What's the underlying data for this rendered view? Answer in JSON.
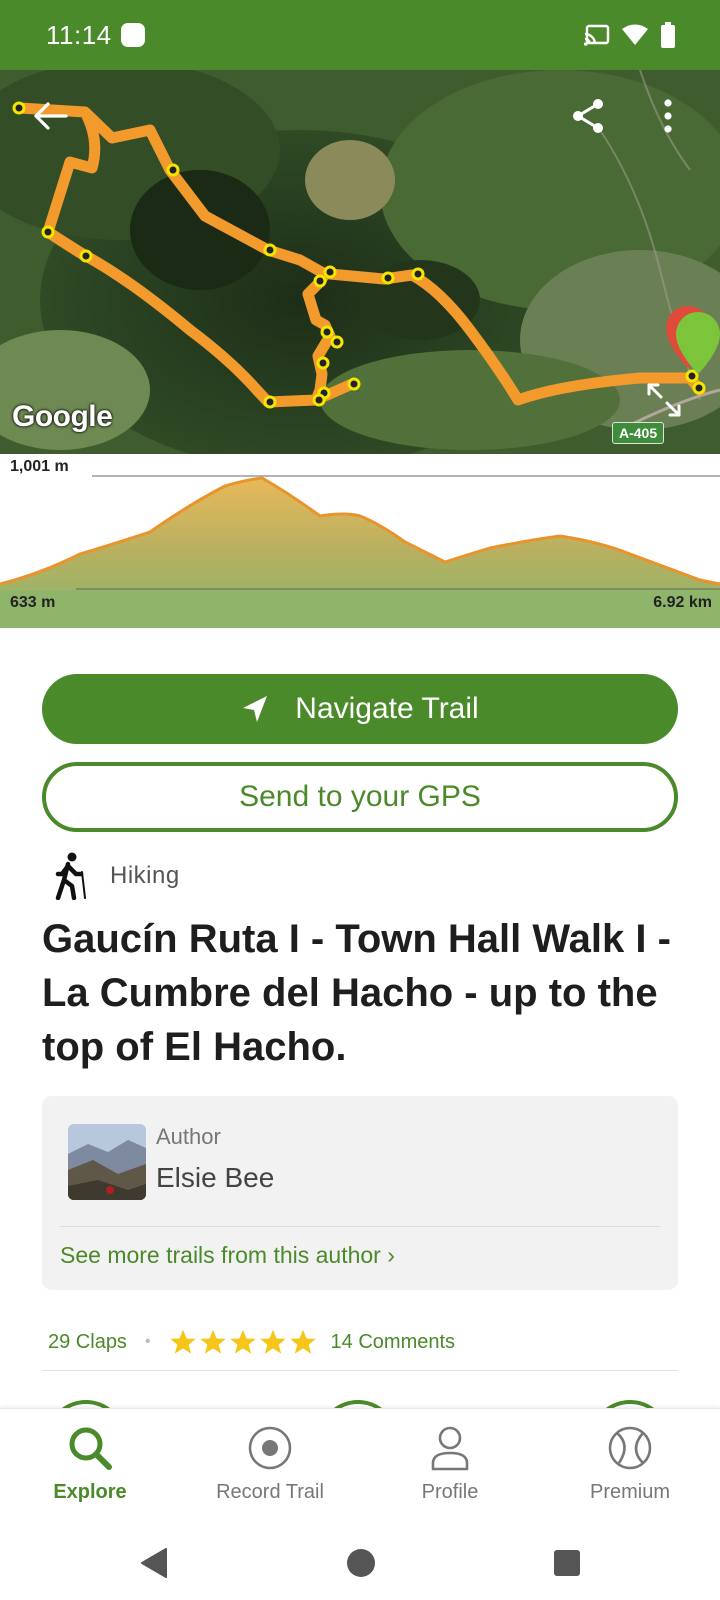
{
  "status_bar": {
    "time": "11:14",
    "icons": [
      "cast-icon",
      "wifi-icon",
      "battery-icon"
    ]
  },
  "map": {
    "attribution": "Google",
    "road_label": "A-405",
    "buttons": [
      "back-arrow-icon",
      "share-icon",
      "more-vert-icon",
      "expand-icon"
    ]
  },
  "elevation": {
    "max_label": "1,001 m",
    "min_label": "633 m",
    "distance_label": "6.92 km"
  },
  "actions": {
    "navigate_label": "Navigate Trail",
    "gps_label": "Send to your GPS"
  },
  "trail": {
    "activity": "Hiking",
    "title": "Gaucín Ruta I - Town Hall Walk I - La Cumbre del Hacho - up to the top of El Hacho."
  },
  "author": {
    "caption": "Author",
    "name": "Elsie Bee",
    "more_link": "See more trails from this author ›"
  },
  "stats": {
    "claps": "29 Claps",
    "rating": 5,
    "comments": "14 Comments"
  },
  "bottom_nav": {
    "items": [
      {
        "label": "Explore",
        "icon": "search-icon",
        "active": true
      },
      {
        "label": "Record Trail",
        "icon": "record-icon",
        "active": false
      },
      {
        "label": "Profile",
        "icon": "person-icon",
        "active": false
      },
      {
        "label": "Premium",
        "icon": "tennis-ball-icon",
        "active": false
      }
    ]
  },
  "colors": {
    "brand_green": "#4b8a2a",
    "route_orange": "#f39a2c",
    "star_yellow": "#f5c518"
  }
}
